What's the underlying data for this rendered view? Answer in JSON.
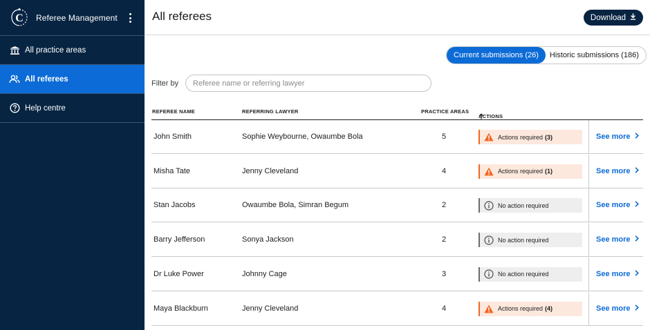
{
  "sidebar": {
    "brand": "Referee Management",
    "logo_icon": "crest-logo-icon",
    "items": [
      {
        "label": "All practice areas",
        "icon": "institution-icon",
        "active": false
      },
      {
        "label": "All referees",
        "icon": "people-icon",
        "active": true
      },
      {
        "label": "Help centre",
        "icon": "help-circle-icon",
        "active": false
      }
    ]
  },
  "header": {
    "title": "All referees",
    "download_label": "Download",
    "download_icon": "download-icon"
  },
  "tabs": [
    {
      "label": "Current submissions (26)",
      "active": true
    },
    {
      "label": "Historic submissions (186)",
      "active": false
    }
  ],
  "filter": {
    "label": "Filter by",
    "placeholder": "Referee name or referring lawyer",
    "value": ""
  },
  "table": {
    "columns": [
      "REFEREE NAME",
      "REFERRING LAWYER",
      "PRACTICE AREAS",
      "ACTIONS"
    ],
    "sort_icon": "arrow-up-icon",
    "see_more_label": "See more",
    "rows": [
      {
        "name": "John Smith",
        "lawyer": "Sophie Weybourne, Owaumbe Bola",
        "areas": "5",
        "status": "warn",
        "action_text": "Actions required",
        "action_count": "(3)"
      },
      {
        "name": "Misha Tate",
        "lawyer": "Jenny Cleveland",
        "areas": "4",
        "status": "warn",
        "action_text": "Actions required",
        "action_count": "(1)"
      },
      {
        "name": "Stan Jacobs",
        "lawyer": "Owaumbe Bola, Simran Begum",
        "areas": "2",
        "status": "info",
        "action_text": "No action required",
        "action_count": ""
      },
      {
        "name": "Barry Jefferson",
        "lawyer": "Sonya Jackson",
        "areas": "2",
        "status": "info",
        "action_text": "No action required",
        "action_count": ""
      },
      {
        "name": "Dr Luke Power",
        "lawyer": "Johnny Cage",
        "areas": "3",
        "status": "info",
        "action_text": "No action required",
        "action_count": ""
      },
      {
        "name": "Maya Blackburn",
        "lawyer": "Jenny Cleveland",
        "areas": "4",
        "status": "warn",
        "action_text": "Actions required",
        "action_count": "(4)"
      }
    ]
  },
  "colors": {
    "sidebar_bg": "#072442",
    "accent": "#0c6bd6",
    "warn": "#f26722",
    "warn_bg": "#fde8de",
    "info_bg": "#eeeeee"
  }
}
